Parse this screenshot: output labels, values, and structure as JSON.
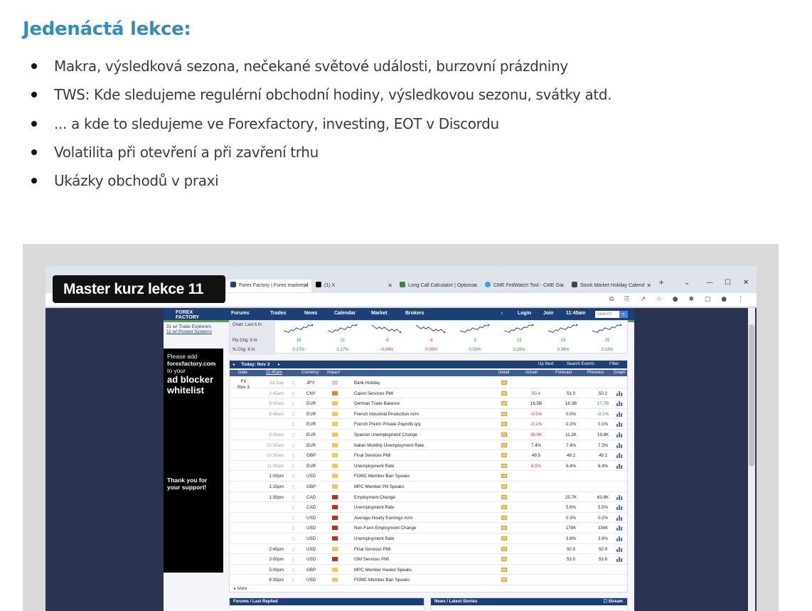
{
  "page": {
    "heading": "Jedenáctá lekce:",
    "bullets": [
      "Makra, výsledková sezona, nečekané světové události, burzovní prázdniny",
      "TWS: Kde sledujeme regulérní obchodní hodiny, výsledkovou sezonu, svátky atd.",
      "... a kde to sledujeme ve Forexfactory, investing, EOT v Discordu",
      "Volatilita při otevření a při zavření trhu",
      "Ukázky obchodů v praxi"
    ]
  },
  "video": {
    "title_badge": "Master kurz lekce 11"
  },
  "browser": {
    "tabs": [
      {
        "label": "Forex Factory | Forex markets f",
        "fav": "#1d3f78"
      },
      {
        "label": "(1) X",
        "fav": "#000000"
      },
      {
        "label": "Long Call Calculator | Options",
        "fav": "#2e8b3d"
      },
      {
        "label": "CME FedWatch Tool - CME Gr",
        "fav": "#3aa0e0"
      },
      {
        "label": "Stock Market Holiday Calend",
        "fav": "#444444"
      }
    ],
    "new_tab": "+",
    "win_controls": [
      "⌄",
      "—",
      "☐",
      "✕"
    ]
  },
  "forexfactory": {
    "logo": [
      "FOREX",
      "FACTORY"
    ],
    "nav": [
      "Forums",
      "Trades",
      "News",
      "Calendar",
      "Market",
      "Brokers"
    ],
    "login": "Login",
    "join": "Join",
    "clock": "11:45am",
    "search_placeholder": "Search",
    "systems_links": [
      "31 w/ Trade Explorers",
      "11 w/ Posted Systems"
    ],
    "ad": {
      "line1": "Please add",
      "line2": "forexfactory.com",
      "line3": "to your",
      "line4": "ad blocker",
      "line5": "whitelist",
      "thanks1": "Thank you for",
      "thanks2": "your support!"
    },
    "market": {
      "chart_label": "Chart: Last 6 hr",
      "pip_label": "Pip Chg: 6 hr",
      "pct_label": "% Chg: 6 hr",
      "pips": [
        "18",
        "21",
        "-6",
        "-8",
        "3",
        "13",
        "23",
        "25"
      ],
      "pcts": [
        "0.17%",
        "0.17%",
        "-0.04%",
        "-0.09%",
        "0.02%",
        "0.20%",
        "0.38%",
        "0.13%"
      ]
    },
    "calendar": {
      "today_label": "Today: Nov 3",
      "up_next": "Up Next",
      "search_events": "Search Events",
      "filter": "Filter",
      "columns": [
        "Date",
        "11:45am",
        "Currency",
        "Impact",
        "Detail",
        "Actual",
        "Forecast",
        "Previous",
        "Graph"
      ],
      "date_day": "Fri",
      "date_date": "Nov 3",
      "rows": [
        {
          "time": "All Day",
          "cur": "JPY",
          "impact": "none",
          "event": "Bank Holiday",
          "actual": "",
          "forecast": "",
          "previous": "",
          "past": true,
          "actual_class": "",
          "prev_class": ""
        },
        {
          "time": "2:45am",
          "cur": "CNY",
          "impact": "med",
          "event": "Caixin Services PMI",
          "actual": "50.4",
          "forecast": "51.0",
          "previous": "50.2",
          "past": true,
          "actual_class": "red",
          "prev_class": ""
        },
        {
          "time": "8:00am",
          "cur": "EUR",
          "impact": "low",
          "event": "German Trade Balance",
          "actual": "16.5B",
          "forecast": "16.3B",
          "previous": "17.7B",
          "past": true,
          "actual_class": "",
          "prev_class": "green"
        },
        {
          "time": "8:45am",
          "cur": "EUR",
          "impact": "low",
          "event": "French Industrial Production m/m",
          "actual": "-0.5%",
          "forecast": "0.0%",
          "previous": "-0.1%",
          "past": true,
          "actual_class": "red",
          "prev_class": "green"
        },
        {
          "time": "",
          "cur": "EUR",
          "impact": "low",
          "event": "French Prelim Private Payrolls q/q",
          "actual": "-0.1%",
          "forecast": "0.2%",
          "previous": "0.1%",
          "past": true,
          "actual_class": "red",
          "prev_class": ""
        },
        {
          "time": "9:00am",
          "cur": "EUR",
          "impact": "low",
          "event": "Spanish Unemployment Change",
          "actual": "36.9K",
          "forecast": "11.2K",
          "previous": "19.8K",
          "past": true,
          "actual_class": "red",
          "prev_class": ""
        },
        {
          "time": "10:00am",
          "cur": "EUR",
          "impact": "low",
          "event": "Italian Monthly Unemployment Rate",
          "actual": "7.4%",
          "forecast": "7.4%",
          "previous": "7.3%",
          "past": true,
          "actual_class": "",
          "prev_class": ""
        },
        {
          "time": "10:30am",
          "cur": "GBP",
          "impact": "low",
          "event": "Final Services PMI",
          "actual": "49.5",
          "forecast": "49.2",
          "previous": "49.2",
          "past": true,
          "actual_class": "",
          "prev_class": ""
        },
        {
          "time": "11:00am",
          "cur": "EUR",
          "impact": "low",
          "event": "Unemployment Rate",
          "actual": "6.5%",
          "forecast": "6.4%",
          "previous": "6.4%",
          "past": true,
          "actual_class": "red",
          "prev_class": ""
        },
        {
          "time": "1:00pm",
          "cur": "USD",
          "impact": "low",
          "event": "FOMC Member Barr Speaks",
          "actual": "",
          "forecast": "",
          "previous": "",
          "past": false,
          "actual_class": "",
          "prev_class": ""
        },
        {
          "time": "1:15pm",
          "cur": "GBP",
          "impact": "low",
          "event": "MPC Member Pill Speaks",
          "actual": "",
          "forecast": "",
          "previous": "",
          "past": false,
          "actual_class": "",
          "prev_class": ""
        },
        {
          "time": "1:30pm",
          "cur": "CAD",
          "impact": "high",
          "event": "Employment Change",
          "actual": "",
          "forecast": "25.7K",
          "previous": "63.8K",
          "past": false,
          "actual_class": "",
          "prev_class": ""
        },
        {
          "time": "",
          "cur": "CAD",
          "impact": "high",
          "event": "Unemployment Rate",
          "actual": "",
          "forecast": "5.6%",
          "previous": "5.5%",
          "past": false,
          "actual_class": "",
          "prev_class": ""
        },
        {
          "time": "",
          "cur": "USD",
          "impact": "high",
          "event": "Average Hourly Earnings m/m",
          "actual": "",
          "forecast": "0.3%",
          "previous": "0.2%",
          "past": false,
          "actual_class": "",
          "prev_class": ""
        },
        {
          "time": "",
          "cur": "USD",
          "impact": "high",
          "event": "Non-Farm Employment Change",
          "actual": "",
          "forecast": "178K",
          "previous": "336K",
          "past": false,
          "actual_class": "",
          "prev_class": ""
        },
        {
          "time": "",
          "cur": "USD",
          "impact": "high",
          "event": "Unemployment Rate",
          "actual": "",
          "forecast": "3.8%",
          "previous": "3.8%",
          "past": false,
          "actual_class": "",
          "prev_class": ""
        },
        {
          "time": "2:45pm",
          "cur": "USD",
          "impact": "low",
          "event": "Final Services PMI",
          "actual": "",
          "forecast": "50.9",
          "previous": "50.9",
          "past": false,
          "actual_class": "",
          "prev_class": ""
        },
        {
          "time": "3:00pm",
          "cur": "USD",
          "impact": "high",
          "event": "ISM Services PMI",
          "actual": "",
          "forecast": "53.0",
          "previous": "53.6",
          "past": false,
          "actual_class": "",
          "prev_class": ""
        },
        {
          "time": "5:00pm",
          "cur": "GBP",
          "impact": "low",
          "event": "MPC Member Haskel Speaks",
          "actual": "",
          "forecast": "",
          "previous": "",
          "past": false,
          "actual_class": "",
          "prev_class": ""
        },
        {
          "time": "8:30pm",
          "cur": "USD",
          "impact": "low",
          "event": "FOMC Member Barr Speaks",
          "actual": "",
          "forecast": "",
          "previous": "",
          "past": false,
          "actual_class": "",
          "prev_class": ""
        }
      ],
      "more": "More"
    },
    "bottom": {
      "forums": "Forums / Last Replied",
      "news": "News / Latest Stories",
      "stream": "Stream"
    }
  },
  "colors": {
    "heading": "#2e8fbf",
    "ff_blue": "#1d3f78",
    "impact_high": "#d0261f",
    "impact_med": "#e8862a",
    "impact_low": "#f2c94c",
    "impact_none": "#cfcfcf"
  }
}
